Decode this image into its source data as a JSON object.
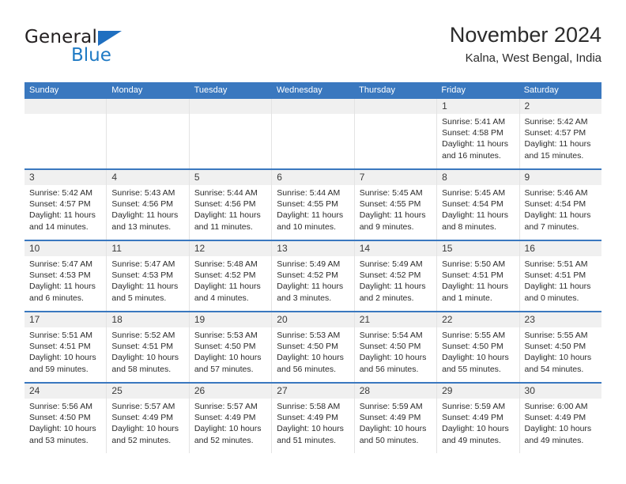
{
  "brand": {
    "name_part1": "General",
    "name_part2": "Blue"
  },
  "header": {
    "title": "November 2024",
    "subtitle": "Kalna, West Bengal, India"
  },
  "weekday_headers": [
    "Sunday",
    "Monday",
    "Tuesday",
    "Wednesday",
    "Thursday",
    "Friday",
    "Saturday"
  ],
  "labels": {
    "sunrise_prefix": "Sunrise: ",
    "sunset_prefix": "Sunset: ",
    "daylight_prefix": "Daylight: "
  },
  "colors": {
    "header_blue": "#3a78bf",
    "brand_blue": "#1f7ac4",
    "daynum_band": "#f0f0f0",
    "cell_border": "#e3e3e3"
  },
  "weeks": [
    [
      {
        "day": "",
        "empty": true
      },
      {
        "day": "",
        "empty": true
      },
      {
        "day": "",
        "empty": true
      },
      {
        "day": "",
        "empty": true
      },
      {
        "day": "",
        "empty": true
      },
      {
        "day": "1",
        "sunrise": "Sunrise: 5:41 AM",
        "sunset": "Sunset: 4:58 PM",
        "daylight": "Daylight: 11 hours and 16 minutes."
      },
      {
        "day": "2",
        "sunrise": "Sunrise: 5:42 AM",
        "sunset": "Sunset: 4:57 PM",
        "daylight": "Daylight: 11 hours and 15 minutes."
      }
    ],
    [
      {
        "day": "3",
        "sunrise": "Sunrise: 5:42 AM",
        "sunset": "Sunset: 4:57 PM",
        "daylight": "Daylight: 11 hours and 14 minutes."
      },
      {
        "day": "4",
        "sunrise": "Sunrise: 5:43 AM",
        "sunset": "Sunset: 4:56 PM",
        "daylight": "Daylight: 11 hours and 13 minutes."
      },
      {
        "day": "5",
        "sunrise": "Sunrise: 5:44 AM",
        "sunset": "Sunset: 4:56 PM",
        "daylight": "Daylight: 11 hours and 11 minutes."
      },
      {
        "day": "6",
        "sunrise": "Sunrise: 5:44 AM",
        "sunset": "Sunset: 4:55 PM",
        "daylight": "Daylight: 11 hours and 10 minutes."
      },
      {
        "day": "7",
        "sunrise": "Sunrise: 5:45 AM",
        "sunset": "Sunset: 4:55 PM",
        "daylight": "Daylight: 11 hours and 9 minutes."
      },
      {
        "day": "8",
        "sunrise": "Sunrise: 5:45 AM",
        "sunset": "Sunset: 4:54 PM",
        "daylight": "Daylight: 11 hours and 8 minutes."
      },
      {
        "day": "9",
        "sunrise": "Sunrise: 5:46 AM",
        "sunset": "Sunset: 4:54 PM",
        "daylight": "Daylight: 11 hours and 7 minutes."
      }
    ],
    [
      {
        "day": "10",
        "sunrise": "Sunrise: 5:47 AM",
        "sunset": "Sunset: 4:53 PM",
        "daylight": "Daylight: 11 hours and 6 minutes."
      },
      {
        "day": "11",
        "sunrise": "Sunrise: 5:47 AM",
        "sunset": "Sunset: 4:53 PM",
        "daylight": "Daylight: 11 hours and 5 minutes."
      },
      {
        "day": "12",
        "sunrise": "Sunrise: 5:48 AM",
        "sunset": "Sunset: 4:52 PM",
        "daylight": "Daylight: 11 hours and 4 minutes."
      },
      {
        "day": "13",
        "sunrise": "Sunrise: 5:49 AM",
        "sunset": "Sunset: 4:52 PM",
        "daylight": "Daylight: 11 hours and 3 minutes."
      },
      {
        "day": "14",
        "sunrise": "Sunrise: 5:49 AM",
        "sunset": "Sunset: 4:52 PM",
        "daylight": "Daylight: 11 hours and 2 minutes."
      },
      {
        "day": "15",
        "sunrise": "Sunrise: 5:50 AM",
        "sunset": "Sunset: 4:51 PM",
        "daylight": "Daylight: 11 hours and 1 minute."
      },
      {
        "day": "16",
        "sunrise": "Sunrise: 5:51 AM",
        "sunset": "Sunset: 4:51 PM",
        "daylight": "Daylight: 11 hours and 0 minutes."
      }
    ],
    [
      {
        "day": "17",
        "sunrise": "Sunrise: 5:51 AM",
        "sunset": "Sunset: 4:51 PM",
        "daylight": "Daylight: 10 hours and 59 minutes."
      },
      {
        "day": "18",
        "sunrise": "Sunrise: 5:52 AM",
        "sunset": "Sunset: 4:51 PM",
        "daylight": "Daylight: 10 hours and 58 minutes."
      },
      {
        "day": "19",
        "sunrise": "Sunrise: 5:53 AM",
        "sunset": "Sunset: 4:50 PM",
        "daylight": "Daylight: 10 hours and 57 minutes."
      },
      {
        "day": "20",
        "sunrise": "Sunrise: 5:53 AM",
        "sunset": "Sunset: 4:50 PM",
        "daylight": "Daylight: 10 hours and 56 minutes."
      },
      {
        "day": "21",
        "sunrise": "Sunrise: 5:54 AM",
        "sunset": "Sunset: 4:50 PM",
        "daylight": "Daylight: 10 hours and 56 minutes."
      },
      {
        "day": "22",
        "sunrise": "Sunrise: 5:55 AM",
        "sunset": "Sunset: 4:50 PM",
        "daylight": "Daylight: 10 hours and 55 minutes."
      },
      {
        "day": "23",
        "sunrise": "Sunrise: 5:55 AM",
        "sunset": "Sunset: 4:50 PM",
        "daylight": "Daylight: 10 hours and 54 minutes."
      }
    ],
    [
      {
        "day": "24",
        "sunrise": "Sunrise: 5:56 AM",
        "sunset": "Sunset: 4:50 PM",
        "daylight": "Daylight: 10 hours and 53 minutes."
      },
      {
        "day": "25",
        "sunrise": "Sunrise: 5:57 AM",
        "sunset": "Sunset: 4:49 PM",
        "daylight": "Daylight: 10 hours and 52 minutes."
      },
      {
        "day": "26",
        "sunrise": "Sunrise: 5:57 AM",
        "sunset": "Sunset: 4:49 PM",
        "daylight": "Daylight: 10 hours and 52 minutes."
      },
      {
        "day": "27",
        "sunrise": "Sunrise: 5:58 AM",
        "sunset": "Sunset: 4:49 PM",
        "daylight": "Daylight: 10 hours and 51 minutes."
      },
      {
        "day": "28",
        "sunrise": "Sunrise: 5:59 AM",
        "sunset": "Sunset: 4:49 PM",
        "daylight": "Daylight: 10 hours and 50 minutes."
      },
      {
        "day": "29",
        "sunrise": "Sunrise: 5:59 AM",
        "sunset": "Sunset: 4:49 PM",
        "daylight": "Daylight: 10 hours and 49 minutes."
      },
      {
        "day": "30",
        "sunrise": "Sunrise: 6:00 AM",
        "sunset": "Sunset: 4:49 PM",
        "daylight": "Daylight: 10 hours and 49 minutes."
      }
    ]
  ]
}
